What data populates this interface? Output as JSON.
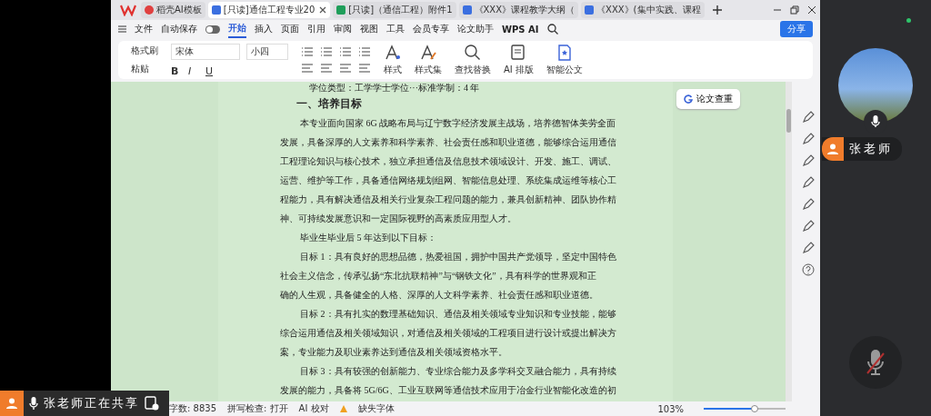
{
  "tabs": [
    {
      "label": "稻壳AI模板",
      "kind": "docer",
      "selected": false
    },
    {
      "label": "[只读]通信工程专业20",
      "kind": "word",
      "selected": true
    },
    {
      "label": "[只读]（通信工程）附件1",
      "kind": "sheet",
      "selected": false
    },
    {
      "label": "《XXX》课程教学大纲（",
      "kind": "word",
      "selected": false
    },
    {
      "label": "《XXX》(集中实践、课程",
      "kind": "word",
      "selected": false
    }
  ],
  "menu": {
    "file": "文件",
    "autosave": "自动保存",
    "autosave_on": false,
    "items": [
      {
        "label": "开始",
        "selected": true
      },
      {
        "label": "插入",
        "selected": false
      },
      {
        "label": "页面",
        "selected": false
      },
      {
        "label": "引用",
        "selected": false
      },
      {
        "label": "审阅",
        "selected": false
      },
      {
        "label": "视图",
        "selected": false
      },
      {
        "label": "工具",
        "selected": false
      },
      {
        "label": "会员专享",
        "selected": false
      },
      {
        "label": "论文助手",
        "selected": false
      }
    ],
    "wps_ai": "WPS AI",
    "share": "分享"
  },
  "ribbon": {
    "format_painter": "格式刷",
    "paste": "粘贴",
    "font": "宋体",
    "size": "小四",
    "format_buttons": [
      "B",
      "I",
      "U"
    ],
    "styles": "样式",
    "style_set": "样式集",
    "find": "查找替换",
    "ai_layout": "AI 排版",
    "smart_doc": "智能公文"
  },
  "side_button": "论文查重",
  "document": [
    {
      "kind": "line",
      "lines": [
        "学位类型：工学学士学位···标准学制：4 年"
      ]
    },
    {
      "kind": "heading",
      "lines": [
        "一、培养目标"
      ]
    },
    {
      "kind": "para",
      "lines": [
        "本专业面向国家 6G 战略布局与辽宁数字经济发展主战场，培养德智体美劳全面",
        "发展，具备深厚的人文素养和科学素养、社会责任感和职业道德，能够综合运用通信",
        "工程理论知识与核心技术，独立承担通信及信息技术领域设计、开发、施工、调试、",
        "运营、维护等工作，具备通信网络规划组网、智能信息处理、系统集成运维等核心工",
        "程能力，具有解决通信及相关行业复杂工程问题的能力，兼具创新精神、团队协作精",
        "神、可持续发展意识和一定国际视野的高素质应用型人才。"
      ]
    },
    {
      "kind": "para",
      "lines": [
        "毕业生毕业后 5 年达到以下目标："
      ]
    },
    {
      "kind": "para",
      "lines": [
        "目标 1：具有良好的思想品德，热爱祖国，拥护中国共产党领导，坚定中国特色",
        "社会主义信念，传承弘扬“东北抗联精神”与“钢铁文化”，具有科学的世界观和正",
        "确的人生观，具备健全的人格、深厚的人文科学素养、社会责任感和职业道德。"
      ]
    },
    {
      "kind": "para",
      "lines": [
        "目标 2：具有扎实的数理基础知识、通信及相关领域专业知识和专业技能，能够",
        "综合运用通信及相关领域知识，对通信及相关领域的工程项目进行设计或提出解决方",
        "案，专业能力及职业素养达到通信及相关领域资格水平。"
      ]
    },
    {
      "kind": "para",
      "lines": [
        "目标 3：具有较强的创新能力、专业综合能力及多学科交叉融合能力，具有持续",
        "发展的能力，具备将 5G/6G、工业互联网等通信技术应用于冶金行业智能化改造的初"
      ]
    }
  ],
  "status": {
    "word_count": "字数: 8835",
    "spell": "拼写检查: 打开",
    "ai_check": "AI 校对",
    "missing_font": "缺失字体",
    "zoom": "103%",
    "zoom_slider": {
      "level": 0.62
    }
  },
  "sharing": {
    "text": "张老师正在共享"
  },
  "participant": {
    "name": "张老师",
    "mic_on": true
  },
  "self_mic_muted": true
}
